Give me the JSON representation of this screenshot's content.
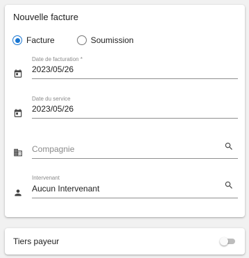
{
  "card": {
    "title": "Nouvelle facture",
    "radio": {
      "options": [
        {
          "label": "Facture",
          "selected": true
        },
        {
          "label": "Soumission",
          "selected": false
        }
      ]
    },
    "fields": {
      "date_facturation": {
        "label": "Date de facturation *",
        "value": "2023/05/26",
        "icon": "calendar-icon"
      },
      "date_service": {
        "label": "Date du service",
        "value": "2023/05/26",
        "icon": "calendar-icon"
      },
      "compagnie": {
        "placeholder": "Compagnie",
        "icon": "building-icon"
      },
      "intervenant": {
        "label": "Intervenant",
        "value": "Aucun Intervenant",
        "icon": "person-icon"
      }
    }
  },
  "tiers": {
    "label": "Tiers payeur",
    "enabled": false
  },
  "colors": {
    "accent": "#1976d2",
    "background": "#f1f1f1",
    "card": "#ffffff"
  }
}
